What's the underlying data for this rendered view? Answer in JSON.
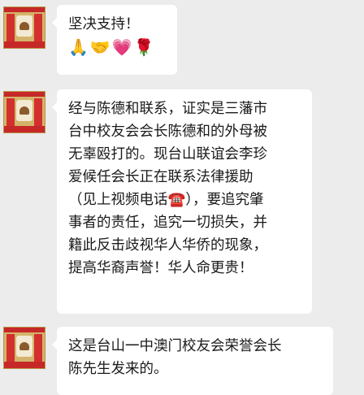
{
  "messages": [
    {
      "lines": [
        "坚决支持！",
        "🙏🤝💗🌹"
      ]
    },
    {
      "lines": [
        "经与陈德和联系，证实是三藩市",
        "台中校友会会长陈德和的外母被",
        "无辜殴打的。现台山联谊会李珍",
        "爱候任会长正在联系法律援助",
        "（见上视频电话☎️），要追究肇",
        "事者的责任，追究一切损失，并",
        "籍此反击歧视华人华侨的现象，",
        "提高华裔声誉！华人命更贵！"
      ]
    },
    {
      "lines": [
        "这是台山一中澳门校友会荣誉会长",
        "陈先生发来的。"
      ]
    }
  ]
}
